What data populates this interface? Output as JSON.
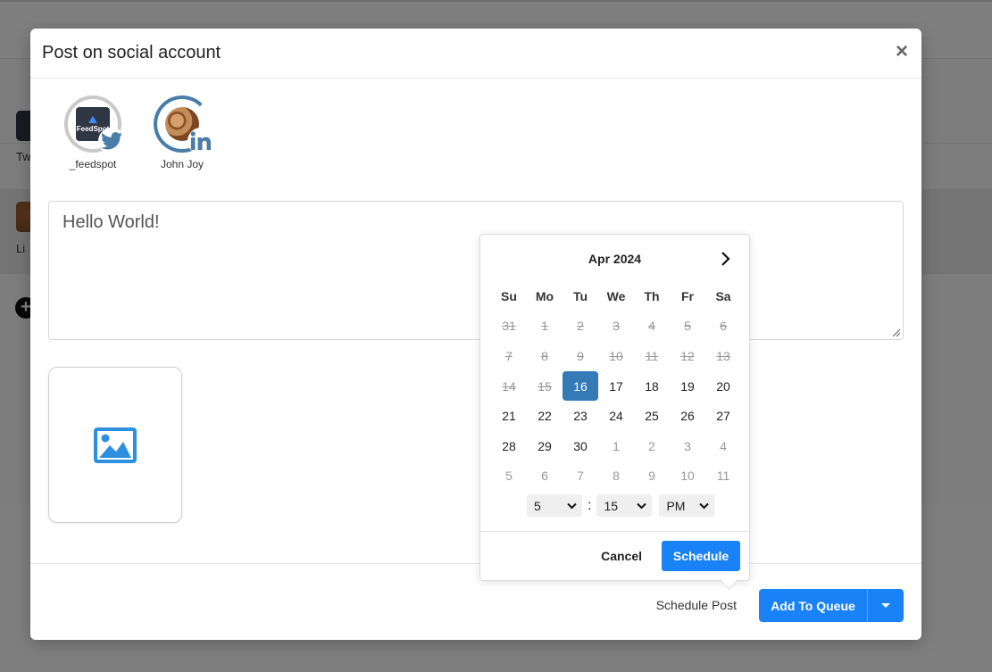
{
  "background": {
    "labels": [
      "Tw",
      "Li"
    ]
  },
  "modal": {
    "title": "Post on social account",
    "close_glyph": "×",
    "accounts": [
      {
        "name": "_feedspot",
        "network_icon": "twitter-icon",
        "logo_text": "FeedSpot"
      },
      {
        "name": "John Joy",
        "network_icon": "linkedin-icon"
      }
    ],
    "post_text": "Hello World!",
    "media_icon": "image-icon",
    "footer": {
      "schedule_label": "Schedule Post",
      "queue_label": "Add To Queue"
    }
  },
  "datepicker": {
    "month_label": "Apr 2024",
    "weekdays": [
      "Su",
      "Mo",
      "Tu",
      "We",
      "Th",
      "Fr",
      "Sa"
    ],
    "weeks": [
      [
        {
          "d": "31",
          "s": "past"
        },
        {
          "d": "1",
          "s": "past"
        },
        {
          "d": "2",
          "s": "past"
        },
        {
          "d": "3",
          "s": "past"
        },
        {
          "d": "4",
          "s": "past"
        },
        {
          "d": "5",
          "s": "past"
        },
        {
          "d": "6",
          "s": "past"
        }
      ],
      [
        {
          "d": "7",
          "s": "past"
        },
        {
          "d": "8",
          "s": "past"
        },
        {
          "d": "9",
          "s": "past"
        },
        {
          "d": "10",
          "s": "past"
        },
        {
          "d": "11",
          "s": "past"
        },
        {
          "d": "12",
          "s": "past"
        },
        {
          "d": "13",
          "s": "past"
        }
      ],
      [
        {
          "d": "14",
          "s": "past"
        },
        {
          "d": "15",
          "s": "past"
        },
        {
          "d": "16",
          "s": "selected"
        },
        {
          "d": "17",
          "s": ""
        },
        {
          "d": "18",
          "s": ""
        },
        {
          "d": "19",
          "s": ""
        },
        {
          "d": "20",
          "s": ""
        }
      ],
      [
        {
          "d": "21",
          "s": ""
        },
        {
          "d": "22",
          "s": ""
        },
        {
          "d": "23",
          "s": ""
        },
        {
          "d": "24",
          "s": ""
        },
        {
          "d": "25",
          "s": ""
        },
        {
          "d": "26",
          "s": ""
        },
        {
          "d": "27",
          "s": ""
        }
      ],
      [
        {
          "d": "28",
          "s": ""
        },
        {
          "d": "29",
          "s": ""
        },
        {
          "d": "30",
          "s": ""
        },
        {
          "d": "1",
          "s": "other"
        },
        {
          "d": "2",
          "s": "other"
        },
        {
          "d": "3",
          "s": "other"
        },
        {
          "d": "4",
          "s": "other"
        }
      ],
      [
        {
          "d": "5",
          "s": "other"
        },
        {
          "d": "6",
          "s": "other"
        },
        {
          "d": "7",
          "s": "other"
        },
        {
          "d": "8",
          "s": "other"
        },
        {
          "d": "9",
          "s": "other"
        },
        {
          "d": "10",
          "s": "other"
        },
        {
          "d": "11",
          "s": "other"
        }
      ]
    ],
    "hour": "5",
    "minute": "15",
    "ampm": "PM",
    "colon": ":",
    "cancel_label": "Cancel",
    "schedule_label": "Schedule",
    "colors": {
      "selected": "#337ab7",
      "primary": "#1a82f7"
    }
  }
}
